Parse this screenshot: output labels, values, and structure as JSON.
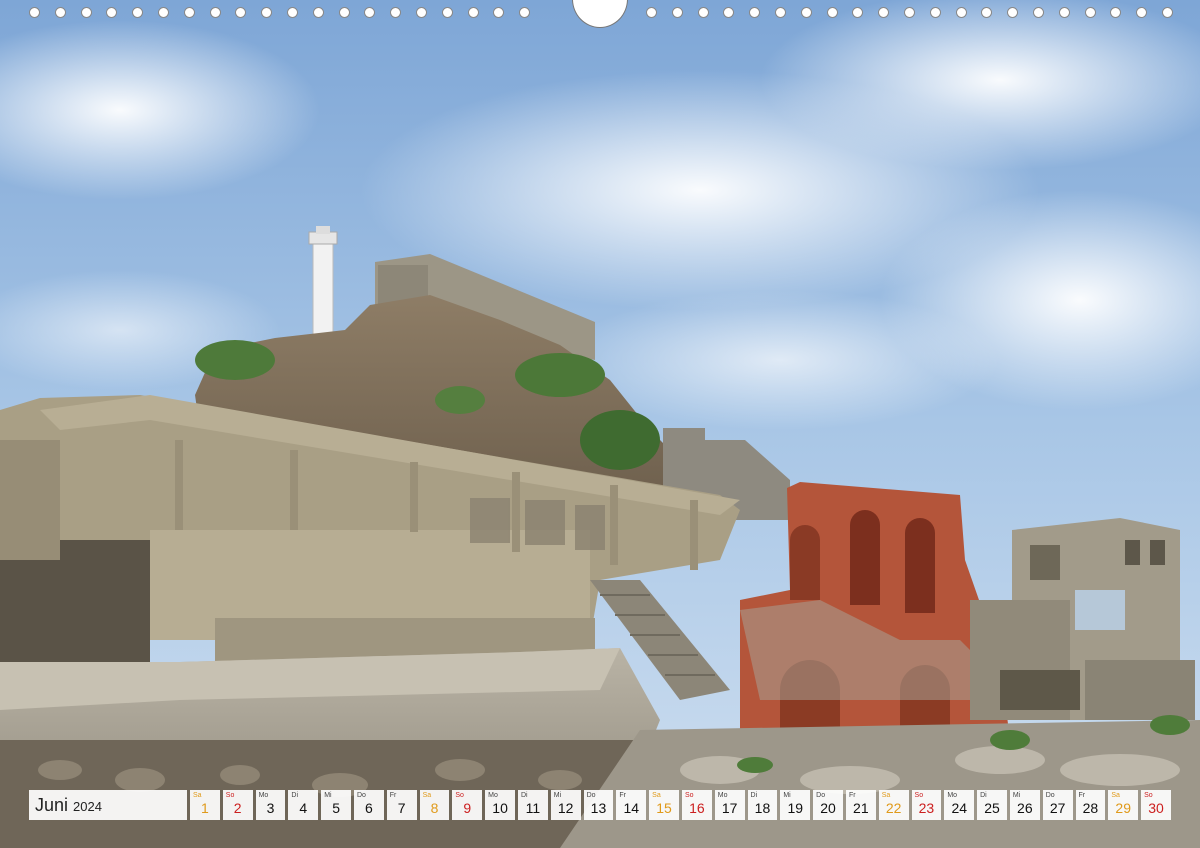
{
  "calendar": {
    "month": "Juni",
    "year": "2024",
    "days": [
      {
        "dow": "Sa",
        "num": "1",
        "type": "sat"
      },
      {
        "dow": "So",
        "num": "2",
        "type": "sun"
      },
      {
        "dow": "Mo",
        "num": "3",
        "type": "wk"
      },
      {
        "dow": "Di",
        "num": "4",
        "type": "wk"
      },
      {
        "dow": "Mi",
        "num": "5",
        "type": "wk"
      },
      {
        "dow": "Do",
        "num": "6",
        "type": "wk"
      },
      {
        "dow": "Fr",
        "num": "7",
        "type": "wk"
      },
      {
        "dow": "Sa",
        "num": "8",
        "type": "sat"
      },
      {
        "dow": "So",
        "num": "9",
        "type": "sun"
      },
      {
        "dow": "Mo",
        "num": "10",
        "type": "wk"
      },
      {
        "dow": "Di",
        "num": "11",
        "type": "wk"
      },
      {
        "dow": "Mi",
        "num": "12",
        "type": "wk"
      },
      {
        "dow": "Do",
        "num": "13",
        "type": "wk"
      },
      {
        "dow": "Fr",
        "num": "14",
        "type": "wk"
      },
      {
        "dow": "Sa",
        "num": "15",
        "type": "sat"
      },
      {
        "dow": "So",
        "num": "16",
        "type": "sun"
      },
      {
        "dow": "Mo",
        "num": "17",
        "type": "wk"
      },
      {
        "dow": "Di",
        "num": "18",
        "type": "wk"
      },
      {
        "dow": "Mi",
        "num": "19",
        "type": "wk"
      },
      {
        "dow": "Do",
        "num": "20",
        "type": "wk"
      },
      {
        "dow": "Fr",
        "num": "21",
        "type": "wk"
      },
      {
        "dow": "Sa",
        "num": "22",
        "type": "sat"
      },
      {
        "dow": "So",
        "num": "23",
        "type": "sun"
      },
      {
        "dow": "Mo",
        "num": "24",
        "type": "wk"
      },
      {
        "dow": "Di",
        "num": "25",
        "type": "wk"
      },
      {
        "dow": "Mi",
        "num": "26",
        "type": "wk"
      },
      {
        "dow": "Do",
        "num": "27",
        "type": "wk"
      },
      {
        "dow": "Fr",
        "num": "28",
        "type": "wk"
      },
      {
        "dow": "Sa",
        "num": "29",
        "type": "sat"
      },
      {
        "dow": "So",
        "num": "30",
        "type": "sun"
      }
    ]
  },
  "colors": {
    "saturday": "#e09a1a",
    "sunday": "#cc1f1f",
    "sky": "#8fb4de",
    "brick": "#b4553a",
    "concrete": "#b7ac92"
  }
}
